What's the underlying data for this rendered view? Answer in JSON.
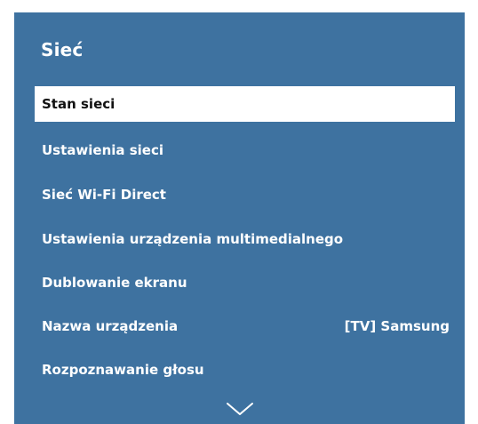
{
  "menu": {
    "title": "Sieć",
    "items": [
      {
        "label": "Stan sieci",
        "value": ""
      },
      {
        "label": "Ustawienia sieci",
        "value": ""
      },
      {
        "label": "Sieć Wi-Fi Direct",
        "value": ""
      },
      {
        "label": "Ustawienia urządzenia multimedialnego",
        "value": ""
      },
      {
        "label": "Dublowanie ekranu",
        "value": ""
      },
      {
        "label": "Nazwa urządzenia",
        "value": "[TV] Samsung"
      },
      {
        "label": "Rozpoznawanie głosu",
        "value": ""
      }
    ],
    "selected_index": 0,
    "scroll_icon": "chevron-down-icon"
  },
  "colors": {
    "panel_background": "#3e72a0",
    "selected_background": "#ffffff",
    "text": "#ffffff",
    "selected_text": "#111111"
  }
}
